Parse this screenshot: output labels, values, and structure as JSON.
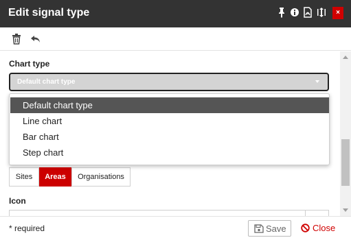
{
  "dialog": {
    "title": "Edit signal type",
    "title_icons": [
      "pin-icon",
      "info-icon",
      "pdf-icon",
      "resize-icon"
    ],
    "close_symbol": "×"
  },
  "toolbar": {
    "icons": [
      "trash-icon",
      "undo-icon"
    ]
  },
  "form": {
    "chart_type_label": "Chart type",
    "chart_type_selected": "Default chart type",
    "chart_type_options": [
      "Default chart type",
      "Line chart",
      "Bar chart",
      "Step chart"
    ],
    "scope_tabs": [
      "Sites",
      "Areas",
      "Organisations"
    ],
    "scope_active": "Areas",
    "icon_label": "Icon"
  },
  "footer": {
    "required_note": "* required",
    "save_label": "Save",
    "close_label": "Close"
  },
  "colors": {
    "titlebar": "#333333",
    "accent_red": "#cc0000",
    "selected_option_bg": "#555555"
  }
}
